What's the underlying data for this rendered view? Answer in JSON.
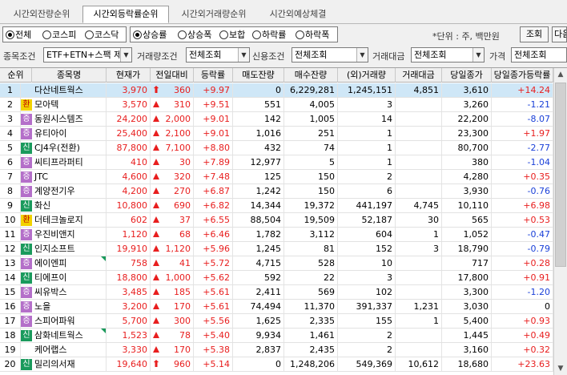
{
  "tabs": [
    "시간외잔량순위",
    "시간외등락률순위",
    "시간외거래량순위",
    "시간외예상체결"
  ],
  "active_tab": 1,
  "market": {
    "options": [
      "전체",
      "코스피",
      "코스닥"
    ],
    "selected": 0
  },
  "sort": {
    "options": [
      "상승률",
      "상승폭",
      "보합",
      "하락률",
      "하락폭"
    ],
    "selected": 0
  },
  "unit_label": "*단위 : 주, 백만원",
  "buttons": {
    "query": "조회",
    "next": "다음"
  },
  "filters": {
    "item_cond_label": "종목조건",
    "item_cond_value": "ETF+ETN+스팩 제외",
    "volume_cond_label": "거래량조건",
    "volume_cond_value": "전체조회",
    "credit_cond_label": "신용조건",
    "credit_cond_value": "전체조회",
    "amount_label": "거래대금",
    "amount_value": "전체조회",
    "price_label": "가격",
    "price_value": "전체조회"
  },
  "columns": [
    "순위",
    "종목명",
    "현재가",
    "전일대비",
    "등락률",
    "매도잔량",
    "매수잔량",
    "(외)거래량",
    "거래대금",
    "당일종가",
    "당일종가등락률"
  ],
  "rows": [
    {
      "rank": "1",
      "badge": "",
      "name": "다산네트웍스",
      "price": "3,970",
      "mark": "arrow",
      "change": "360",
      "rate": "+9.97",
      "sell": "0",
      "buy": "6,229,281",
      "vol": "1,245,151",
      "amt": "4,851",
      "close": "3,610",
      "crate": "+14.24",
      "cdir": "up",
      "sel": true,
      "corner": false
    },
    {
      "rank": "2",
      "badge": "환",
      "name": "모아텍",
      "price": "3,570",
      "mark": "tri",
      "change": "310",
      "rate": "+9.51",
      "sell": "551",
      "buy": "4,005",
      "vol": "3",
      "amt": "",
      "close": "3,260",
      "crate": "-1.21",
      "cdir": "dn",
      "sel": false,
      "corner": false
    },
    {
      "rank": "3",
      "badge": "증",
      "name": "동원시스템즈",
      "price": "24,200",
      "mark": "tri",
      "change": "2,000",
      "rate": "+9.01",
      "sell": "142",
      "buy": "1,005",
      "vol": "14",
      "amt": "",
      "close": "22,200",
      "crate": "-8.07",
      "cdir": "dn",
      "sel": false,
      "corner": false
    },
    {
      "rank": "4",
      "badge": "증",
      "name": "유티아이",
      "price": "25,400",
      "mark": "tri",
      "change": "2,100",
      "rate": "+9.01",
      "sell": "1,016",
      "buy": "251",
      "vol": "1",
      "amt": "",
      "close": "23,300",
      "crate": "+1.97",
      "cdir": "up",
      "sel": false,
      "corner": false
    },
    {
      "rank": "5",
      "badge": "신",
      "name": "CJ4우(전환)",
      "price": "87,800",
      "mark": "tri",
      "change": "7,100",
      "rate": "+8.80",
      "sell": "432",
      "buy": "74",
      "vol": "1",
      "amt": "",
      "close": "80,700",
      "crate": "-2.77",
      "cdir": "dn",
      "sel": false,
      "corner": false
    },
    {
      "rank": "6",
      "badge": "증",
      "name": "씨티프라퍼티",
      "price": "410",
      "mark": "tri",
      "change": "30",
      "rate": "+7.89",
      "sell": "12,977",
      "buy": "5",
      "vol": "1",
      "amt": "",
      "close": "380",
      "crate": "-1.04",
      "cdir": "dn",
      "sel": false,
      "corner": false
    },
    {
      "rank": "7",
      "badge": "증",
      "name": "JTC",
      "price": "4,600",
      "mark": "tri",
      "change": "320",
      "rate": "+7.48",
      "sell": "125",
      "buy": "150",
      "vol": "2",
      "amt": "",
      "close": "4,280",
      "crate": "+0.35",
      "cdir": "up",
      "sel": false,
      "corner": false
    },
    {
      "rank": "8",
      "badge": "증",
      "name": "계양전기우",
      "price": "4,200",
      "mark": "tri",
      "change": "270",
      "rate": "+6.87",
      "sell": "1,242",
      "buy": "150",
      "vol": "6",
      "amt": "",
      "close": "3,930",
      "crate": "-0.76",
      "cdir": "dn",
      "sel": false,
      "corner": false
    },
    {
      "rank": "9",
      "badge": "신",
      "name": "화신",
      "price": "10,800",
      "mark": "tri",
      "change": "690",
      "rate": "+6.82",
      "sell": "14,344",
      "buy": "19,372",
      "vol": "441,197",
      "amt": "4,745",
      "close": "10,110",
      "crate": "+6.98",
      "cdir": "up",
      "sel": false,
      "corner": false
    },
    {
      "rank": "10",
      "badge": "환",
      "name": "더테크놀로지",
      "price": "602",
      "mark": "tri",
      "change": "37",
      "rate": "+6.55",
      "sell": "88,504",
      "buy": "19,509",
      "vol": "52,187",
      "amt": "30",
      "close": "565",
      "crate": "+0.53",
      "cdir": "up",
      "sel": false,
      "corner": false
    },
    {
      "rank": "11",
      "badge": "증",
      "name": "우진비앤지",
      "price": "1,120",
      "mark": "tri",
      "change": "68",
      "rate": "+6.46",
      "sell": "1,782",
      "buy": "3,112",
      "vol": "604",
      "amt": "1",
      "close": "1,052",
      "crate": "-0.47",
      "cdir": "dn",
      "sel": false,
      "corner": false
    },
    {
      "rank": "12",
      "badge": "신",
      "name": "인지소프트",
      "price": "19,910",
      "mark": "tri",
      "change": "1,120",
      "rate": "+5.96",
      "sell": "1,245",
      "buy": "81",
      "vol": "152",
      "amt": "3",
      "close": "18,790",
      "crate": "-0.79",
      "cdir": "dn",
      "sel": false,
      "corner": false
    },
    {
      "rank": "13",
      "badge": "증",
      "name": "에이엔피",
      "price": "758",
      "mark": "tri",
      "change": "41",
      "rate": "+5.72",
      "sell": "4,715",
      "buy": "528",
      "vol": "10",
      "amt": "",
      "close": "717",
      "crate": "+0.28",
      "cdir": "up",
      "sel": false,
      "corner": true
    },
    {
      "rank": "14",
      "badge": "신",
      "name": "티에프이",
      "price": "18,800",
      "mark": "tri",
      "change": "1,000",
      "rate": "+5.62",
      "sell": "592",
      "buy": "22",
      "vol": "3",
      "amt": "",
      "close": "17,800",
      "crate": "+0.91",
      "cdir": "up",
      "sel": false,
      "corner": false
    },
    {
      "rank": "15",
      "badge": "증",
      "name": "씨유박스",
      "price": "3,485",
      "mark": "tri",
      "change": "185",
      "rate": "+5.61",
      "sell": "2,411",
      "buy": "569",
      "vol": "102",
      "amt": "",
      "close": "3,300",
      "crate": "-1.20",
      "cdir": "dn",
      "sel": false,
      "corner": false
    },
    {
      "rank": "16",
      "badge": "증",
      "name": "노을",
      "price": "3,200",
      "mark": "tri",
      "change": "170",
      "rate": "+5.61",
      "sell": "74,494",
      "buy": "11,370",
      "vol": "391,337",
      "amt": "1,231",
      "close": "3,030",
      "crate": "0",
      "cdir": "",
      "sel": false,
      "corner": false
    },
    {
      "rank": "17",
      "badge": "증",
      "name": "스피어파워",
      "price": "5,700",
      "mark": "tri",
      "change": "300",
      "rate": "+5.56",
      "sell": "1,625",
      "buy": "2,335",
      "vol": "155",
      "amt": "1",
      "close": "5,400",
      "crate": "+0.93",
      "cdir": "up",
      "sel": false,
      "corner": false
    },
    {
      "rank": "18",
      "badge": "신",
      "name": "삼화네트웍스",
      "price": "1,523",
      "mark": "tri",
      "change": "78",
      "rate": "+5.40",
      "sell": "9,934",
      "buy": "1,461",
      "vol": "2",
      "amt": "",
      "close": "1,445",
      "crate": "+0.49",
      "cdir": "up",
      "sel": false,
      "corner": true
    },
    {
      "rank": "19",
      "badge": "",
      "name": "케어랩스",
      "price": "3,330",
      "mark": "tri",
      "change": "170",
      "rate": "+5.38",
      "sell": "2,837",
      "buy": "2,435",
      "vol": "2",
      "amt": "",
      "close": "3,160",
      "crate": "+0.32",
      "cdir": "up",
      "sel": false,
      "corner": false
    },
    {
      "rank": "20",
      "badge": "신",
      "name": "밀리의서재",
      "price": "19,640",
      "mark": "arrow",
      "change": "960",
      "rate": "+5.14",
      "sell": "0",
      "buy": "1,248,206",
      "vol": "549,369",
      "amt": "10,612",
      "close": "18,680",
      "crate": "+23.63",
      "cdir": "up",
      "sel": false,
      "corner": false
    }
  ]
}
